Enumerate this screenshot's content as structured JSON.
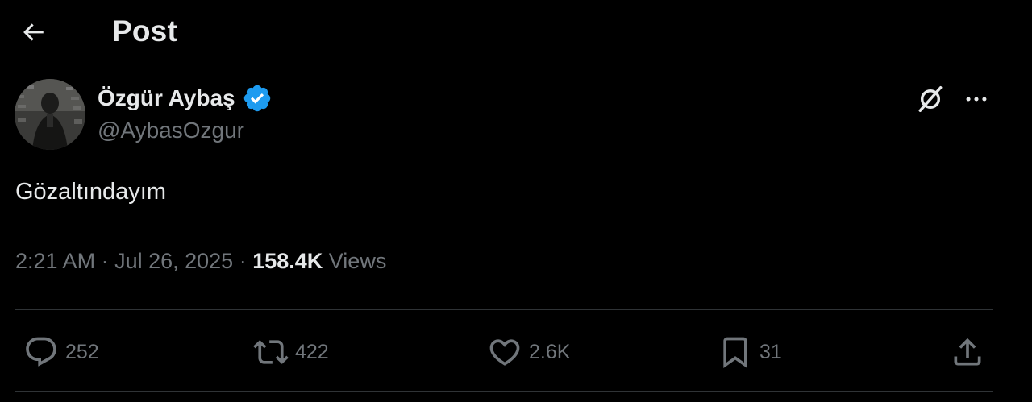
{
  "header": {
    "title": "Post"
  },
  "author": {
    "display_name": "Özgür Aybaş",
    "handle": "@AybasOzgur",
    "verified": true
  },
  "tweet": {
    "text": "Gözaltındayım",
    "time": "2:21 AM",
    "separator": " · ",
    "date": "Jul 26, 2025",
    "views_count": "158.4K",
    "views_label": "Views"
  },
  "actions": {
    "replies": "252",
    "reposts": "422",
    "likes": "2.6K",
    "bookmarks": "31"
  },
  "icons": {
    "back": "back-arrow-icon",
    "verified": "verified-badge-icon",
    "grok": "grok-icon",
    "more": "more-icon",
    "reply": "reply-icon",
    "repost": "repost-icon",
    "like": "heart-icon",
    "bookmark": "bookmark-icon",
    "share": "share-icon"
  },
  "colors": {
    "background": "#000000",
    "text_primary": "#e7e9ea",
    "text_secondary": "#71767b",
    "divider": "#2f3336",
    "verified": "#1d9bf0"
  }
}
